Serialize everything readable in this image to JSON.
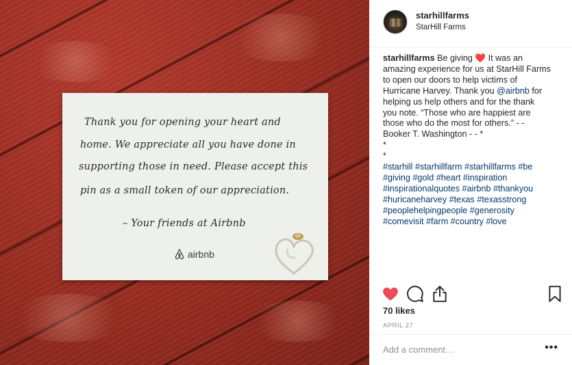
{
  "post": {
    "username": "starhillfarms",
    "location": "StarHill Farms",
    "caption_lines": [
      [
        "starhillfarms",
        " Be giving ",
        "❤️",
        " It was an"
      ],
      "amazing experience for us at StarHill Farms",
      "to open our doors to help victims of",
      [
        "Hurricane Harvey. Thank you ",
        "@airbnb",
        " for"
      ],
      "helping us help others and for the thank",
      "you note. “Those who are happiest are",
      "those who do the most for others.” - -",
      "Booker T. Washington - - *",
      "*",
      "*",
      "#starhill #starhillfarm #starhillfarms #be",
      "#giving #gold #heart #inspiration",
      "#inspirationalquotes #airbnb #thankyou",
      "#huricaneharvey #texas #texasstrong",
      "#peoplehelpingpeople #generosity",
      "#comevisit #farm #country #love"
    ],
    "likes": "70 likes",
    "date": "APRIL 27",
    "comment_placeholder": "Add a comment…",
    "more_label": "•••"
  },
  "card": {
    "lines": [
      "Thank you for opening your heart and",
      "home. We appreciate all you have done in",
      "supporting those in need. Please accept this",
      "pin as a small token of our appreciation.",
      "– Your friends at Airbnb"
    ],
    "brand": "airbnb"
  },
  "icons": {
    "like": "heart-icon",
    "comment": "comment-icon",
    "share": "share-icon",
    "save": "bookmark-icon",
    "avatar": "avatar",
    "brand_logo": "airbnb-logo-icon"
  },
  "colors": {
    "like_red": "#ed4956",
    "hashtag_blue": "#00376b",
    "muted_gray": "#8e8e8e"
  }
}
